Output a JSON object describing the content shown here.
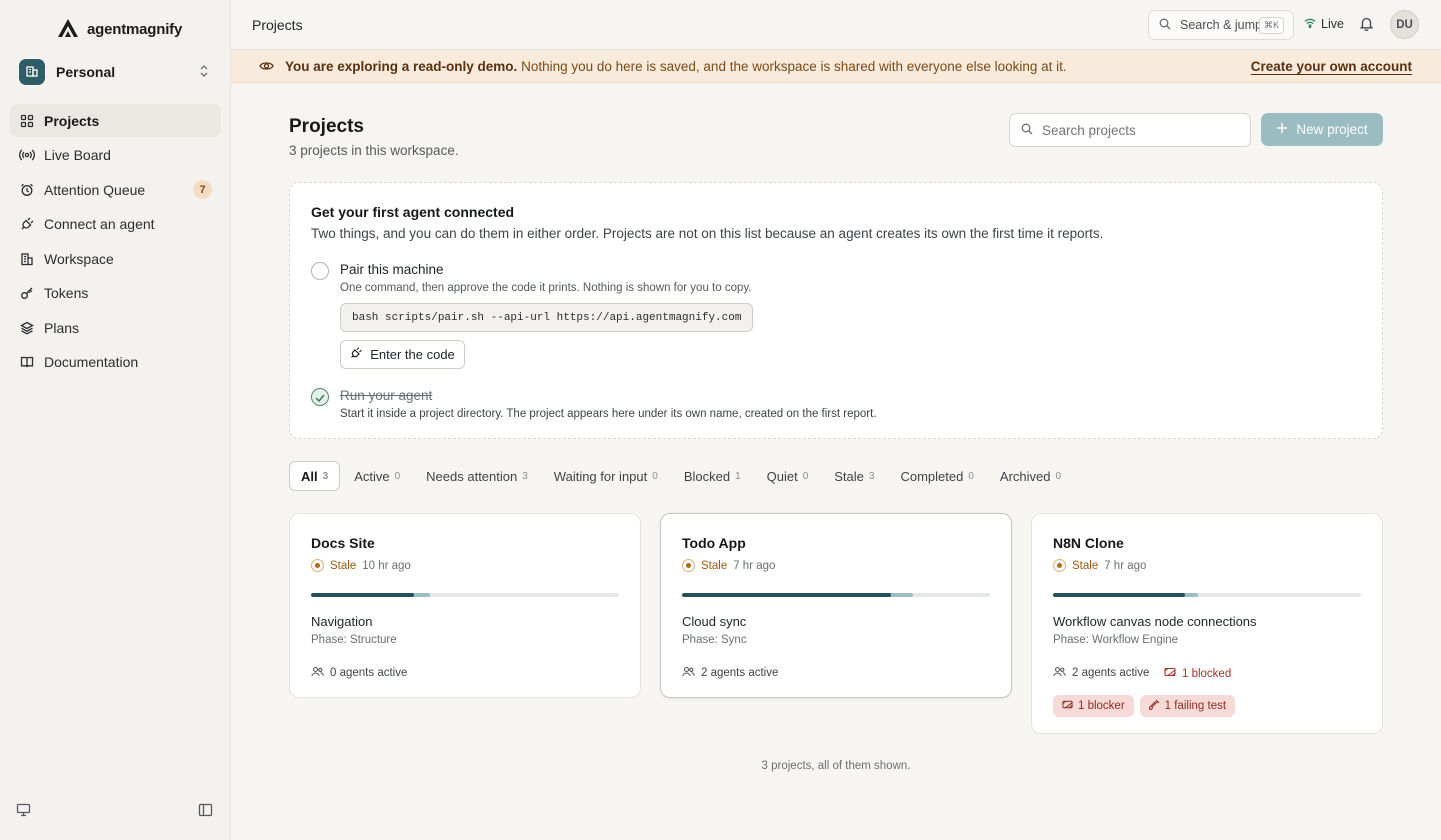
{
  "app": {
    "brand": "agentmagnify"
  },
  "workspace": {
    "name": "Personal"
  },
  "sidebar": {
    "items": [
      {
        "label": "Projects",
        "icon": "grid-icon",
        "active": true
      },
      {
        "label": "Live Board",
        "icon": "broadcast-icon"
      },
      {
        "label": "Attention Queue",
        "icon": "alarm-icon",
        "badge": "7"
      },
      {
        "label": "Connect an agent",
        "icon": "plug-icon"
      },
      {
        "label": "Workspace",
        "icon": "building-icon"
      },
      {
        "label": "Tokens",
        "icon": "key-icon"
      },
      {
        "label": "Plans",
        "icon": "layers-icon"
      },
      {
        "label": "Documentation",
        "icon": "book-icon"
      }
    ]
  },
  "topbar": {
    "title": "Projects",
    "search_label": "Search & jump",
    "search_kbd": "⌘K",
    "live_label": "Live",
    "user_initials": "DU"
  },
  "banner": {
    "strong": "You are exploring a read-only demo.",
    "text": " Nothing you do here is saved, and the workspace is shared with everyone else looking at it.",
    "link": "Create your own account"
  },
  "main": {
    "title": "Projects",
    "subtitle": "3 projects in this workspace.",
    "search_placeholder": "Search projects",
    "new_project_label": "New project"
  },
  "onboarding": {
    "title": "Get your first agent connected",
    "subtitle": "Two things, and you can do them in either order. Projects are not on this list because an agent creates its own the first time it reports.",
    "step1": {
      "title": "Pair this machine",
      "desc": "One command, then approve the code it prints. Nothing is shown for you to copy.",
      "command": "bash scripts/pair.sh --api-url https://api.agentmagnify.com",
      "button": "Enter the code"
    },
    "step2": {
      "title": "Run your agent",
      "desc": "Start it inside a project directory. The project appears here under its own name, created on the first report.",
      "done": true
    }
  },
  "tabs": [
    {
      "label": "All",
      "count": "3",
      "active": true
    },
    {
      "label": "Active",
      "count": "0"
    },
    {
      "label": "Needs attention",
      "count": "3"
    },
    {
      "label": "Waiting for input",
      "count": "0"
    },
    {
      "label": "Blocked",
      "count": "1"
    },
    {
      "label": "Quiet",
      "count": "0"
    },
    {
      "label": "Stale",
      "count": "3"
    },
    {
      "label": "Completed",
      "count": "0"
    },
    {
      "label": "Archived",
      "count": "0"
    }
  ],
  "projects": [
    {
      "name": "Docs Site",
      "status": "Stale",
      "time": "10 hr ago",
      "progress_done": 0.335,
      "progress_total": 0.385,
      "task": "Navigation",
      "phase": "Phase: Structure",
      "agents": "0 agents active"
    },
    {
      "name": "Todo App",
      "status": "Stale",
      "time": "7 hr ago",
      "progress_done": 0.68,
      "progress_total": 0.75,
      "task": "Cloud sync",
      "phase": "Phase: Sync",
      "agents": "2 agents active"
    },
    {
      "name": "N8N Clone",
      "status": "Stale",
      "time": "7 hr ago",
      "progress_done": 0.43,
      "progress_total": 0.47,
      "task": "Workflow canvas node connections",
      "phase": "Phase: Workflow Engine",
      "agents": "2 agents active",
      "blocked": "1 blocked",
      "chips": [
        "1 blocker",
        "1 failing test"
      ]
    }
  ],
  "footer": "3 projects, all of them shown.",
  "colors": {
    "accent": "#24505a",
    "stale": "#b06a12",
    "blocked": "#a3322b",
    "banner_bg": "#f8ebdb"
  }
}
